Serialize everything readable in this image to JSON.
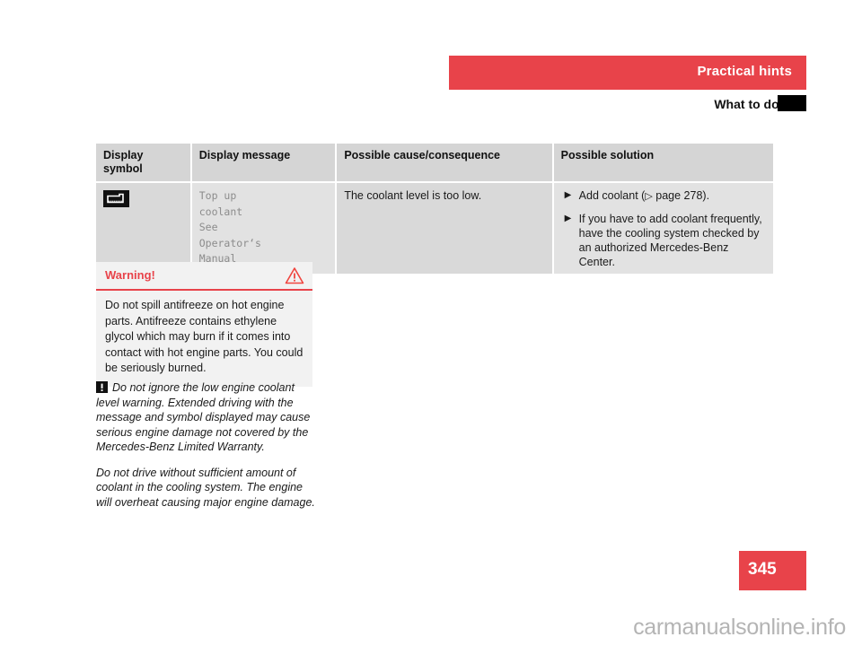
{
  "header": {
    "band_title": "Practical hints",
    "subtitle": "What to do if …"
  },
  "table": {
    "columns": [
      "Display symbol",
      "Display message",
      "Possible cause/consequence",
      "Possible solution"
    ],
    "rows": [
      {
        "symbol_icon": "coolant-level-warning-icon",
        "message_lines": [
          "Top up",
          "coolant",
          "See",
          "Operator‘s",
          "Manual"
        ],
        "cause": "The coolant level is too low.",
        "solutions": [
          {
            "prefix": "Add coolant (",
            "arrow": "▷",
            "reference": " page 278).",
            "text": "Add coolant (▷ page 278)."
          },
          {
            "text": "If you have to add coolant frequently, have the cooling system checked by an authorized Mercedes-Benz Center."
          }
        ]
      }
    ]
  },
  "warning": {
    "title": "Warning!",
    "icon": "warning-triangle-icon",
    "body": "Do not spill antifreeze on hot engine parts. Antifreeze contains ethylene glycol which may burn if it comes into contact with hot engine parts. You could be seriously burned."
  },
  "note": {
    "icon": "exclamation-box-icon",
    "paragraphs": [
      "Do not ignore the low engine coolant level warning. Extended driving with the message and symbol displayed may cause serious engine damage not covered by the Mercedes-Benz Limited Warranty.",
      "Do not drive without sufficient amount of coolant in the cooling system. The engine will overheat causing major engine damage."
    ]
  },
  "footer": {
    "page_number": "345",
    "watermark": "carmanualsonline.info"
  },
  "colors": {
    "accent_red": "#e8434a",
    "table_header_gray": "#d5d5d5",
    "table_cell_gray": "#d9d9d9",
    "table_cell_gray_alt": "#e2e2e2",
    "warning_box_gray": "#f2f2f2",
    "watermark_gray": "#b4b4b4"
  }
}
